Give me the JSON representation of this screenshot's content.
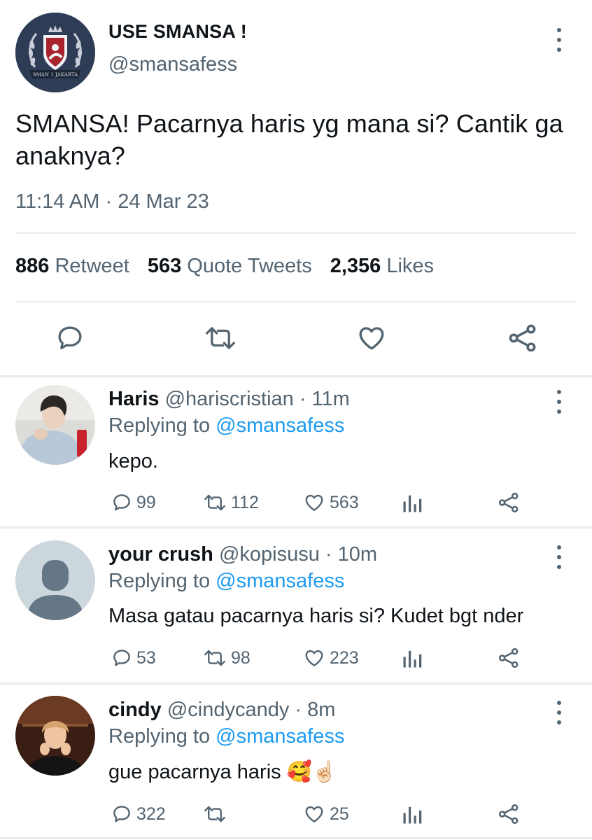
{
  "main_tweet": {
    "name": "USE SMANSA !",
    "handle": "@smansafess",
    "avatar_text": "SMAN 1 JAKARTA",
    "text": "SMANSA! Pacarnya haris yg mana si? Cantik ga anaknya?",
    "time": "11:14 AM",
    "separator": "·",
    "date": "24 Mar 23",
    "stats": {
      "retweets_count": "886",
      "retweets_label": "Retweet",
      "quotes_count": "563",
      "quotes_label": "Quote Tweets",
      "likes_count": "2,356",
      "likes_label": "Likes"
    }
  },
  "replies": [
    {
      "name": "Haris",
      "handle": "@hariscristian",
      "time": "· 11m",
      "replying_prefix": "Replying to",
      "replying_to": "@smansafess",
      "text": "kepo.",
      "replies": "99",
      "retweets": "112",
      "likes": "563"
    },
    {
      "name": "your crush",
      "handle": "@kopisusu",
      "time": "· 10m",
      "replying_prefix": "Replying to",
      "replying_to": "@smansafess",
      "text": "Masa gatau pacarnya haris si? Kudet bgt nder",
      "replies": "53",
      "retweets": "98",
      "likes": "223"
    },
    {
      "name": "cindy",
      "handle": "@cindycandy",
      "time": "· 8m",
      "replying_prefix": "Replying to",
      "replying_to": "@smansafess",
      "text": "gue pacarnya haris",
      "emoji": "🥰☝🏻",
      "replies": "322",
      "retweets": "",
      "likes": "25"
    }
  ],
  "colors": {
    "text": "#0f1419",
    "muted": "#536471",
    "link": "#1d9bf0",
    "divider": "#e6ecf0"
  },
  "icons": [
    "more-icon",
    "reply-icon",
    "retweet-icon",
    "like-icon",
    "share-icon",
    "analytics-icon"
  ]
}
